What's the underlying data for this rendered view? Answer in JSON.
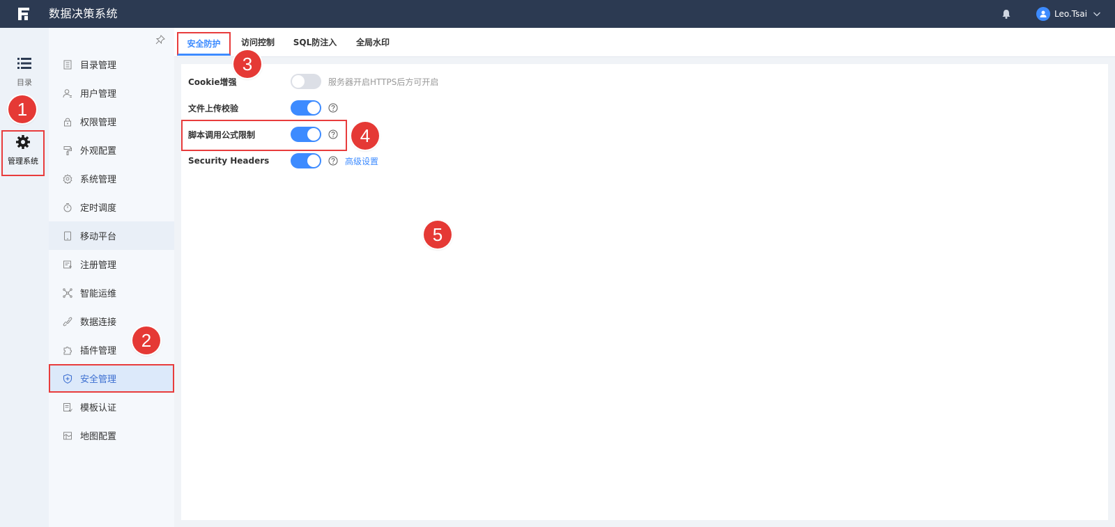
{
  "header": {
    "app_title": "数据决策系统",
    "user_name": "Leo.Tsai"
  },
  "rail": {
    "catalog_label": "目录",
    "admin_label": "管理系统"
  },
  "sidebar": {
    "items": [
      {
        "label": "目录管理",
        "icon": "catalog-icon"
      },
      {
        "label": "用户管理",
        "icon": "user-icon"
      },
      {
        "label": "权限管理",
        "icon": "lock-icon"
      },
      {
        "label": "外观配置",
        "icon": "paint-roller-icon"
      },
      {
        "label": "系统管理",
        "icon": "gear-icon"
      },
      {
        "label": "定时调度",
        "icon": "timer-icon"
      },
      {
        "label": "移动平台",
        "icon": "tablet-icon"
      },
      {
        "label": "注册管理",
        "icon": "register-icon"
      },
      {
        "label": "智能运维",
        "icon": "network-icon"
      },
      {
        "label": "数据连接",
        "icon": "link-icon"
      },
      {
        "label": "插件管理",
        "icon": "puzzle-icon"
      },
      {
        "label": "安全管理",
        "icon": "shield-icon"
      },
      {
        "label": "模板认证",
        "icon": "template-icon"
      },
      {
        "label": "地图配置",
        "icon": "map-icon"
      }
    ],
    "hover_index": 6,
    "active_index": 11
  },
  "tabs": [
    {
      "label": "安全防护",
      "active": true
    },
    {
      "label": "访问控制",
      "active": false
    },
    {
      "label": "SQL防注入",
      "active": false
    },
    {
      "label": "全局水印",
      "active": false
    }
  ],
  "settings": [
    {
      "label": "Cookie增强",
      "on": false,
      "hint": "服务器开启HTTPS后方可开启"
    },
    {
      "label": "文件上传校验",
      "on": true
    },
    {
      "label": "脚本调用公式限制",
      "on": true
    },
    {
      "label": "Security Headers",
      "on": true,
      "link": "高级设置"
    }
  ],
  "badges": [
    "1",
    "2",
    "3",
    "4",
    "5"
  ],
  "colors": {
    "topbar": "#2c3a52",
    "accent": "#3d8bff",
    "highlight_red": "#e83c3c"
  }
}
